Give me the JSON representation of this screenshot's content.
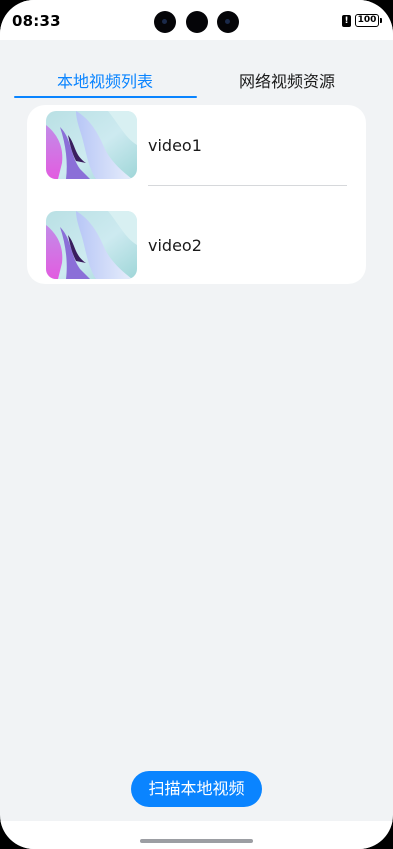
{
  "status_bar": {
    "time": "08:33",
    "battery": "100",
    "alert_glyph": "!",
    "icons": [
      "camera-lens-icon",
      "alert-icon",
      "battery-icon"
    ]
  },
  "tabs": [
    {
      "label": "本地视频列表",
      "active": true
    },
    {
      "label": "网络视频资源",
      "active": false
    }
  ],
  "videos": [
    {
      "title": "video1",
      "thumbnail": "abstract-gradient-thumbnail"
    },
    {
      "title": "video2",
      "thumbnail": "abstract-gradient-thumbnail"
    }
  ],
  "scan_button": {
    "label": "扫描本地视频"
  },
  "colors": {
    "accent": "#0a84ff",
    "background": "#f1f3f5",
    "card": "#ffffff",
    "text": "#1a1a1a"
  }
}
